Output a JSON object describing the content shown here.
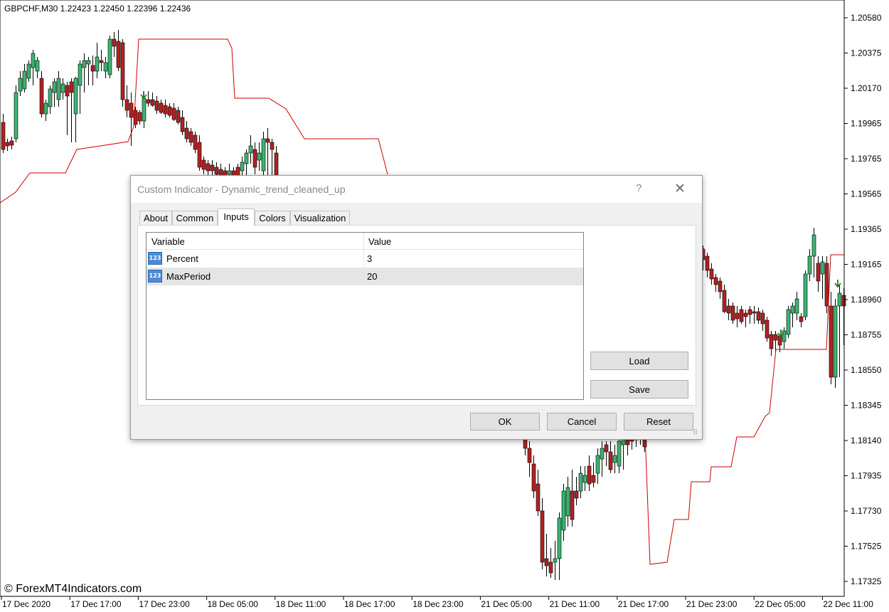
{
  "symbol_header": "GBPCHF,M30  1.22423 1.22450 1.22396 1.22436",
  "watermark": "© ForexMT4Indicators.com",
  "price_scale": [
    "1.20580",
    "1.20375",
    "1.20170",
    "1.19965",
    "1.19765",
    "1.19565",
    "1.19365",
    "1.19165",
    "1.18960",
    "1.18755",
    "1.18550",
    "1.18345",
    "1.18140",
    "1.17935",
    "1.17730",
    "1.17525",
    "1.17325"
  ],
  "time_scale": [
    "17 Dec 2020",
    "17 Dec 17:00",
    "17 Dec 23:00",
    "18 Dec 05:00",
    "18 Dec 11:00",
    "18 Dec 17:00",
    "18 Dec 23:00",
    "21 Dec 05:00",
    "21 Dec 11:00",
    "21 Dec 17:00",
    "21 Dec 23:00",
    "22 Dec 05:00",
    "22 Dec 11:00"
  ],
  "colors": {
    "bull": "#3cb371",
    "bear": "#b22222",
    "line": "#cc0000",
    "arrow": "#1f7a1f"
  },
  "dialog": {
    "title": "Custom Indicator - Dynamic_trend_cleaned_up",
    "help": "?",
    "close": "✕",
    "tabs": [
      "About",
      "Common",
      "Inputs",
      "Colors",
      "Visualization"
    ],
    "active_tab": "Inputs",
    "table": {
      "columns": [
        "Variable",
        "Value"
      ],
      "rows": [
        {
          "icon": "123",
          "name": "Percent",
          "value": "3"
        },
        {
          "icon": "123",
          "name": "MaxPeriod",
          "value": "20"
        }
      ]
    },
    "buttons": {
      "load": "Load",
      "save": "Save",
      "ok": "OK",
      "cancel": "Cancel",
      "reset": "Reset"
    }
  }
}
